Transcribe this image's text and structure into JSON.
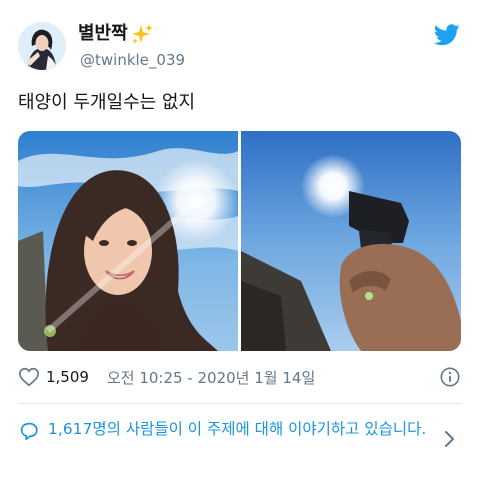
{
  "tweet": {
    "author": {
      "display_name": "별반짝",
      "badge_emoji": "sparkles-icon",
      "handle": "@twinkle_039"
    },
    "text": "태양이 두개일수는 없지",
    "media": [
      {
        "icon": "selfie-photo"
      },
      {
        "icon": "hand-with-gun-photo"
      }
    ],
    "meta": {
      "like_count": "1,509",
      "timestamp": "오전 10:25 - 2020년 1월 14일"
    },
    "conversation": {
      "text": "1,617명의 사람들이 이 주제에 대해 이야기하고 있습니다."
    }
  },
  "colors": {
    "twitter_blue": "#1da1f2",
    "link_blue": "#1b95e0",
    "secondary_text": "#657786",
    "divider": "#e1e8ed"
  }
}
